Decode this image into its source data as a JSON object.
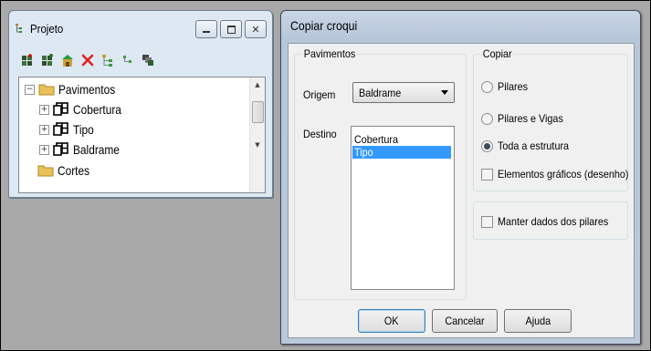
{
  "projeto_window": {
    "title": "Projeto",
    "title_icon": "tree-structure-icon",
    "window_buttons": [
      "minimize-icon",
      "maximize-icon",
      "close-icon"
    ],
    "toolbar_icons": [
      "add-floor-icon",
      "copy-floor-icon",
      "building-icon",
      "delete-icon",
      "tree-expand-icon",
      "tree-collapse-icon",
      "layers-icon"
    ],
    "tree": [
      {
        "label": "Pavimentos",
        "expander": "−",
        "icon": "folder-icon"
      },
      {
        "label": "Cobertura",
        "expander": "+",
        "icon": "floor-icon"
      },
      {
        "label": "Tipo",
        "expander": "+",
        "icon": "floor-icon"
      },
      {
        "label": "Baldrame",
        "expander": "+",
        "icon": "floor-icon"
      },
      {
        "label": "Cortes",
        "expander": "",
        "icon": "folder-icon"
      }
    ]
  },
  "dialog": {
    "title": "Copiar croqui",
    "pavimentos_group": {
      "legend": "Pavimentos",
      "origem_label": "Origem",
      "origem_value": "Baldrame",
      "destino_label": "Destino",
      "destino_items": [
        {
          "label": "Cobertura",
          "selected": false
        },
        {
          "label": "Tipo",
          "selected": true
        }
      ]
    },
    "copiar_group": {
      "legend": "Copiar",
      "options": [
        {
          "label": "Pilares",
          "checked": false
        },
        {
          "label": "Pilares e Vigas",
          "checked": false
        },
        {
          "label": "Toda a estrutura",
          "checked": true
        }
      ],
      "checkbox_label": "Elementos gráficos (desenho)",
      "checkbox_checked": false
    },
    "manter_label": "Manter dados dos pilares",
    "manter_checked": false,
    "buttons": {
      "ok": "OK",
      "cancel": "Cancelar",
      "help": "Ajuda"
    }
  },
  "colors": {
    "selection": "#3399ff",
    "workspace": "#a9a9a9",
    "dialog_frame": "#b7c6d9"
  }
}
